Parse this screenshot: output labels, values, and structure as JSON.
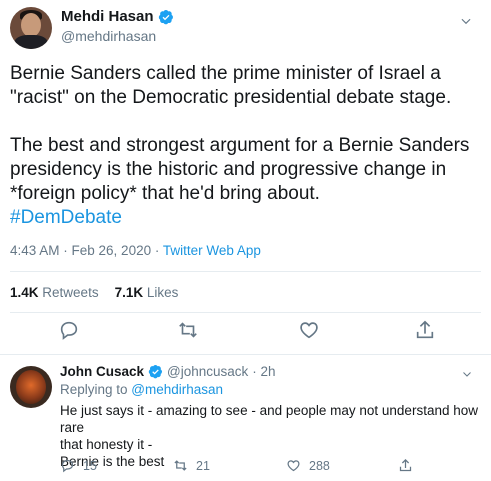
{
  "tweet": {
    "author_name": "Mehdi Hasan",
    "author_handle": "@mehdirhasan",
    "paragraph1": "Bernie Sanders called the prime minister of Israel a \"racist\" on the Democratic presidential debate stage.",
    "paragraph2": "The best and strongest argument for a Bernie Sanders presidency is the historic and progressive change in *foreign policy* that he'd bring about.",
    "hashtag": "#DemDebate",
    "timestamp": "4:43 AM · Feb 26, 2020 · ",
    "source": "Twitter Web App",
    "retweets_count": "1.4K",
    "retweets_label": "Retweets",
    "likes_count": "7.1K",
    "likes_label": "Likes"
  },
  "reply": {
    "author_name": "John Cusack",
    "author_handle": "@johncusack",
    "time": "· 2h",
    "replying_prefix": "Replying to ",
    "replying_to": "@mehdirhasan",
    "line1": "He just says it -  amazing to see - and people may not understand how rare",
    "line2": "that honesty it -",
    "line3": "Bernie is the best",
    "reply_count": "15",
    "retweet_count": "21",
    "like_count": "288"
  },
  "colors": {
    "accent": "#1b95e0",
    "muted": "#657786",
    "text": "#14171a",
    "divider": "#e6ecf0"
  },
  "icons": [
    "verified-badge-icon",
    "chevron-down-icon",
    "reply-icon",
    "retweet-icon",
    "like-icon",
    "share-icon"
  ]
}
